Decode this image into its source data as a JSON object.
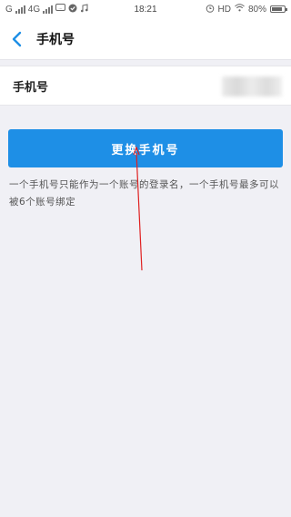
{
  "status_bar": {
    "carrier_left": "G",
    "network": "4G",
    "time": "18:21",
    "hd_label": "HD",
    "battery_percent": "80%",
    "battery_level": 0.8
  },
  "nav": {
    "title": "手机号"
  },
  "phone_row": {
    "label": "手机号",
    "value": ""
  },
  "actions": {
    "change_phone_label": "更换手机号"
  },
  "note": {
    "text": "一个手机号只能作为一个账号的登录名，一个手机号最多可以被6个账号绑定"
  },
  "colors": {
    "accent": "#1e8fe6",
    "annotation": "#e02020"
  }
}
